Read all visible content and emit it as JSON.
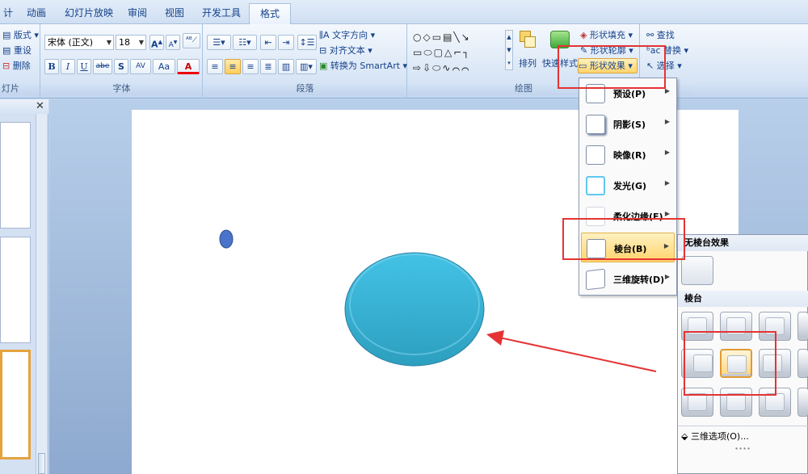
{
  "tabs": [
    "计",
    "动画",
    "幻灯片放映",
    "审阅",
    "视图",
    "开发工具",
    "格式"
  ],
  "slides_group": {
    "layout": "版式",
    "reset": "重设",
    "delete": "删除",
    "label": "灯片"
  },
  "font_group": {
    "font_name": "宋体 (正文)",
    "font_size": "18",
    "label": "字体",
    "bold": "B",
    "italic": "I",
    "underline": "U",
    "strike": "abe",
    "shadow": "S",
    "spacing": "AV",
    "case": "Aa",
    "color": "A"
  },
  "paragraph_group": {
    "text_direction": "文字方向",
    "align_text": "对齐文本",
    "smartart": "转换为 SmartArt",
    "label": "段落"
  },
  "drawing_group": {
    "arrange": "排列",
    "quick_styles": "快速样式",
    "shape_fill": "形状填充",
    "shape_outline": "形状轮廓",
    "shape_effects": "形状效果",
    "label": "绘图"
  },
  "editing_group": {
    "find": "查找",
    "replace": "替换",
    "select": "选择"
  },
  "effects_menu": [
    {
      "label": "预设(P)"
    },
    {
      "label": "阴影(S)"
    },
    {
      "label": "映像(R)"
    },
    {
      "label": "发光(G)"
    },
    {
      "label": "柔化边缘(E)"
    },
    {
      "label": "棱台(B)"
    },
    {
      "label": "三维旋转(D)"
    }
  ],
  "bevel_gallery": {
    "no_bevel_title": "无棱台效果",
    "section_title": "棱台",
    "options_link": "三维选项(O)...",
    "selected_index": 5
  },
  "colors": {
    "highlight_border": "#e53333",
    "ellipse_fill": "#3bb5d8",
    "small_ellipse": "#4a74c9",
    "arrow": "#e53333",
    "menu_highlight": "#ffd46b"
  }
}
